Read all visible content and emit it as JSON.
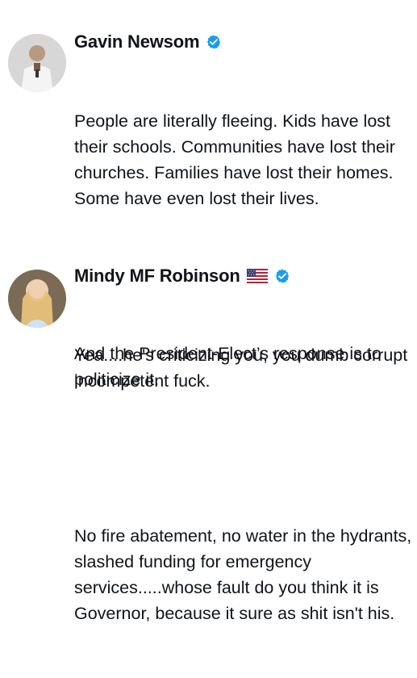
{
  "posts": [
    {
      "author": {
        "name": "Gavin Newsom",
        "verified": true,
        "flag": null
      },
      "text_p1": "People are literally fleeing. Kids have lost their schools. Communities have lost their churches. Families have lost their homes. Some have even lost their lives.",
      "text_p2": "And the President-Elect’s response is to politicize it."
    },
    {
      "author": {
        "name": "Mindy MF Robinson",
        "verified": true,
        "flag": "us-flag"
      },
      "text_p1": "Yea....he's criticizing you, you dumb corrupt incompetent fuck.",
      "text_p2": "No fire abatement, no water in the hydrants, slashed funding for emergency services.....whose fault do you think it is Governor, because it sure as shit isn't his."
    }
  ],
  "colors": {
    "verified_badge": "#1d9bf0",
    "text": "#0f1419",
    "background": "#ffffff"
  }
}
